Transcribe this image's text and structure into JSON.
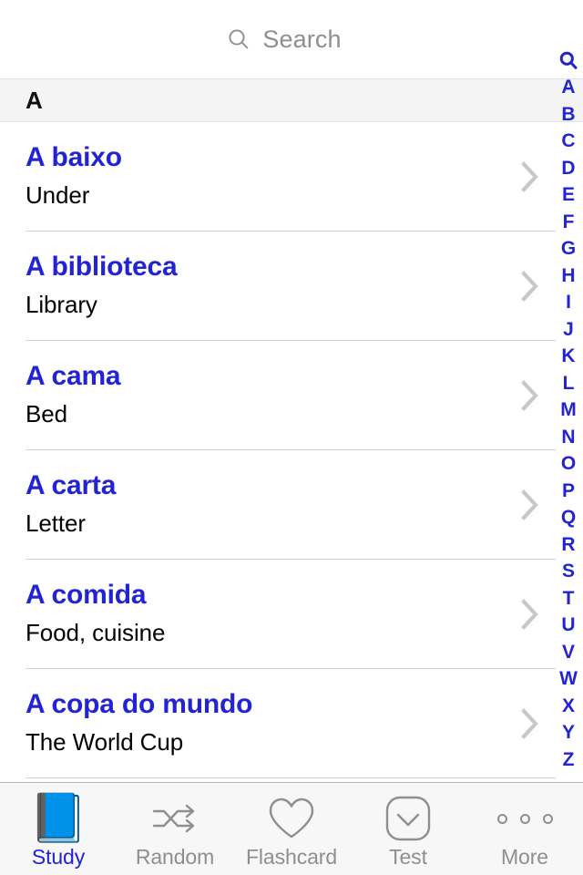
{
  "search": {
    "placeholder": "Search",
    "icon": "search-icon"
  },
  "section": {
    "header": "A"
  },
  "list": {
    "items": [
      {
        "title": "A baixo",
        "subtitle": "Under"
      },
      {
        "title": "A biblioteca",
        "subtitle": "Library"
      },
      {
        "title": "A cama",
        "subtitle": "Bed"
      },
      {
        "title": "A carta",
        "subtitle": "Letter"
      },
      {
        "title": "A comida",
        "subtitle": "Food, cuisine"
      },
      {
        "title": "A copa do mundo",
        "subtitle": "The World Cup"
      }
    ],
    "disclosure_icon": "chevron-right-icon"
  },
  "index_bar": {
    "search_icon": "search-icon",
    "letters": [
      "A",
      "B",
      "C",
      "D",
      "E",
      "F",
      "G",
      "H",
      "I",
      "J",
      "K",
      "L",
      "M",
      "N",
      "O",
      "P",
      "Q",
      "R",
      "S",
      "T",
      "U",
      "V",
      "W",
      "X",
      "Y",
      "Z"
    ]
  },
  "tab_bar": {
    "active": "Study",
    "tabs": [
      {
        "label": "Study",
        "icon": "book-icon",
        "active": true
      },
      {
        "label": "Random",
        "icon": "shuffle-icon",
        "active": false
      },
      {
        "label": "Flashcard",
        "icon": "heart-icon",
        "active": false
      },
      {
        "label": "Test",
        "icon": "check-square-icon",
        "active": false
      },
      {
        "label": "More",
        "icon": "ellipsis-icon",
        "active": false
      }
    ]
  },
  "colors": {
    "accent": "#2323d6",
    "muted": "#8e8e93",
    "separator": "#d3d3d3",
    "section_bg": "#f4f4f4",
    "tabbar_bg": "#f7f7f7"
  }
}
